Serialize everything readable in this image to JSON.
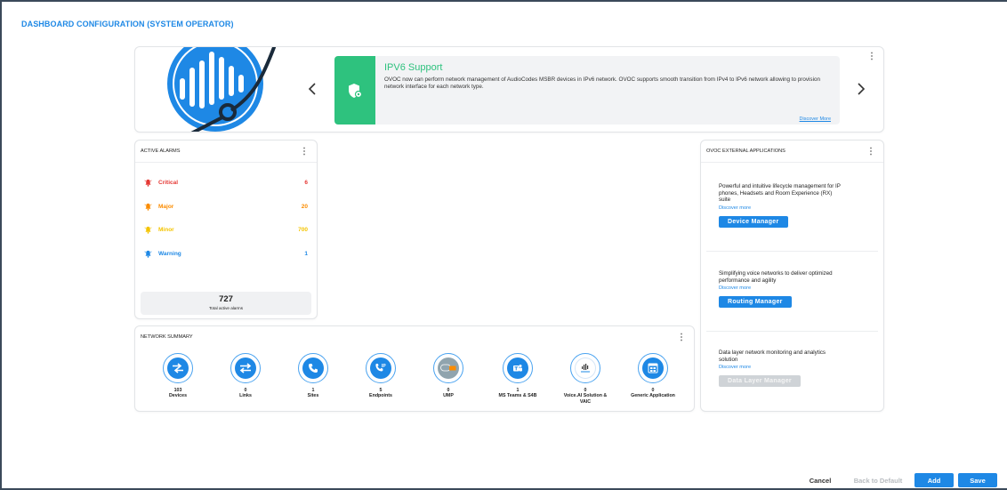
{
  "page_title": "DASHBOARD CONFIGURATION (SYSTEM OPERATOR)",
  "banner": {
    "title": "IPV6 Support",
    "text": "OVOC now can perform network management of AudioCodes MSBR devices in IPv6 network. OVOC supports smooth transition from IPv4 to IPv6 network allowing to provision network interface for each network type.",
    "link": "Discover More",
    "prev_icon": "chevron-left-icon",
    "next_icon": "chevron-right-icon",
    "accent_color": "#2ec27e"
  },
  "alarms": {
    "header": "ACTIVE ALARMS",
    "items": [
      {
        "label": "Critical",
        "value": "6",
        "color": "#e53935"
      },
      {
        "label": "Major",
        "value": "20",
        "color": "#fb8c00"
      },
      {
        "label": "Minor",
        "value": "700",
        "color": "#f4c400"
      },
      {
        "label": "Warning",
        "value": "1",
        "color": "#1e88e5"
      }
    ],
    "total": "727",
    "total_label": "Total active alarms"
  },
  "network": {
    "header": "NETWORK SUMMARY",
    "items": [
      {
        "count": "103",
        "label": "Devices",
        "icon": "devices-icon"
      },
      {
        "count": "0",
        "label": "Links",
        "icon": "links-icon"
      },
      {
        "count": "1",
        "label": "Sites",
        "icon": "sites-icon"
      },
      {
        "count": "5",
        "label": "Endpoints",
        "icon": "endpoints-icon"
      },
      {
        "count": "0",
        "label": "UMP",
        "icon": "ump-icon"
      },
      {
        "count": "1",
        "label": "MS Teams & S4B",
        "icon": "ms-teams-icon"
      },
      {
        "count": "0",
        "label": "Voice.AI Solution & VAIC",
        "icon": "voice-ai-icon"
      },
      {
        "count": "0",
        "label": "Generic Application",
        "icon": "generic-app-icon"
      }
    ]
  },
  "external": {
    "header": "OVOC EXTERNAL APPLICATIONS",
    "apps": [
      {
        "text": "Powerful and intuitive lifecycle management for IP phones, Headsets and Room Experience (RX) suite",
        "link": "Discover more",
        "button": "Device Manager",
        "enabled": true
      },
      {
        "text": "Simplifying voice networks to deliver optimized performance and agility",
        "link": "Discover more",
        "button": "Routing Manager",
        "enabled": true
      },
      {
        "text": "Data layer network monitoring and analytics solution",
        "link": "Discover more",
        "button": "Data Layer Manager",
        "enabled": false
      }
    ]
  },
  "footer": {
    "cancel": "Cancel",
    "back_to_default": "Back to Default",
    "add": "Add",
    "save": "Save"
  }
}
